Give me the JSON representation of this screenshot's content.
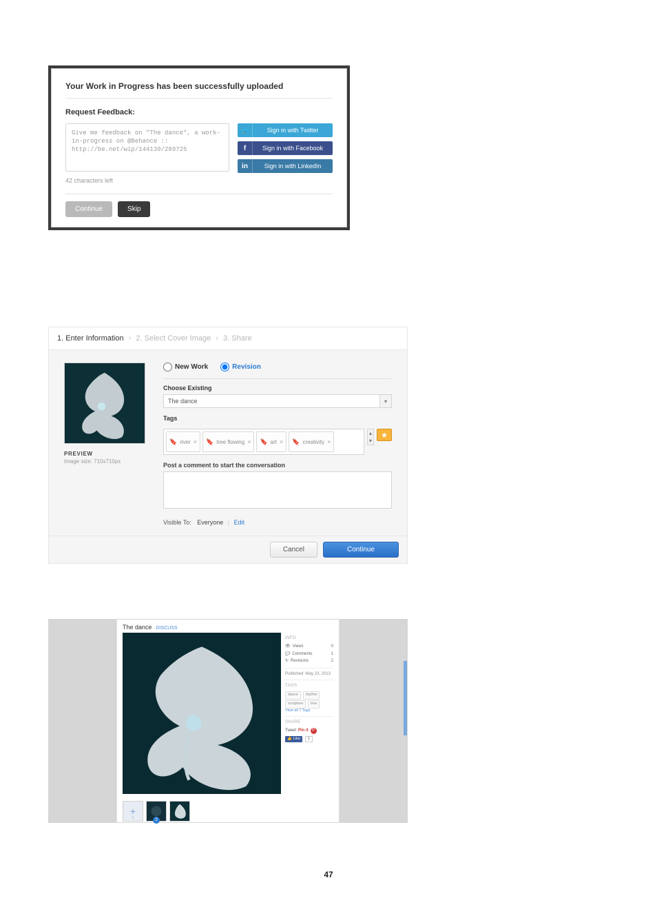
{
  "panel1": {
    "title": "Your Work in Progress has been successfully uploaded",
    "subtitle": "Request Feedback:",
    "textarea_value": "Give me feedback on \"The dance\", a work-in-progress on @Behance :: http://be.net/wip/144139/289725",
    "char_left": "42 characters left",
    "social": {
      "twitter": "Sign in with Twitter",
      "facebook": "Sign in with Facebook",
      "linkedin": "Sign in with LinkedIn"
    },
    "continue_label": "Continue",
    "skip_label": "Skip"
  },
  "panel2": {
    "steps": {
      "s1": "1. Enter Information",
      "s2": "2. Select Cover Image",
      "s3": "3. Share"
    },
    "preview": {
      "label": "PREVIEW",
      "size": "Image size: 710x710px"
    },
    "radios": {
      "newwork": "New Work",
      "revision": "Revision"
    },
    "choose_existing_label": "Choose Existing",
    "choose_existing_value": "The dance",
    "tags_label": "Tags",
    "tags": [
      "river",
      "tree flowing",
      "art",
      "creativity"
    ],
    "comment_label": "Post a comment to start the conversation",
    "visible": {
      "label": "Visible To:",
      "value": "Everyone",
      "edit": "Edit"
    },
    "footer": {
      "cancel": "Cancel",
      "continue": "Continue"
    }
  },
  "panel3": {
    "title": "The dance",
    "subtitle": "DISCUSS",
    "side": {
      "info_head": "INFO",
      "stats": [
        {
          "icon": "👁",
          "label": "Views",
          "value": "0"
        },
        {
          "icon": "💬",
          "label": "Comments",
          "value": "1"
        },
        {
          "icon": "↻",
          "label": "Revisions",
          "value": "2"
        }
      ],
      "published": "Published: May 23, 2013",
      "tags_head": "TAGS",
      "tags": [
        "dance",
        "rhythm",
        "sculpture",
        "tree"
      ],
      "view_all": "View all 7 Tags",
      "share_head": "SHARE",
      "tweet": "Tweet",
      "pin": "Pin it",
      "like": "Like",
      "like_count": "1"
    },
    "thumbs": {
      "add_sub": "1",
      "badge": "2"
    }
  },
  "page_number": "47"
}
